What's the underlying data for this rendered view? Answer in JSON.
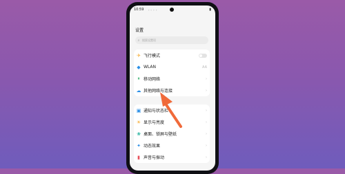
{
  "status": {
    "time": "10:59",
    "icons": "◦ ◦ ◦ ◦",
    "battery": "▮"
  },
  "title": "设置",
  "search": {
    "placeholder": "搜索设置项"
  },
  "groups": [
    {
      "items": [
        {
          "icon": "airplane-icon",
          "glyph": "✈",
          "color": "#f5a623",
          "label": "飞行模式",
          "control": "toggle",
          "value": false
        },
        {
          "icon": "wifi-icon",
          "glyph": "◆",
          "color": "#2b8fe6",
          "label": "WLAN",
          "trailing": "AA"
        },
        {
          "icon": "mobile-network-icon",
          "glyph": "⏸",
          "color": "#3cb371",
          "label": "移动网络",
          "trailing": "›"
        },
        {
          "icon": "cloud-icon",
          "glyph": "☁",
          "color": "#2b8fe6",
          "label": "其他网络与连接",
          "trailing": "›"
        }
      ]
    },
    {
      "items": [
        {
          "icon": "notification-icon",
          "glyph": "▣",
          "color": "#2b8fe6",
          "label": "通知与状态栏",
          "trailing": "›"
        },
        {
          "icon": "brightness-icon",
          "glyph": "☀",
          "color": "#f5a623",
          "label": "显示与亮度",
          "trailing": "›"
        },
        {
          "icon": "wallpaper-icon",
          "glyph": "❀",
          "color": "#2fb5a2",
          "label": "桌面、锁屏与壁纸",
          "trailing": "›"
        },
        {
          "icon": "dynamic-effects-icon",
          "glyph": "✦",
          "color": "#2b8fe6",
          "label": "动态效果",
          "trailing": "›"
        },
        {
          "icon": "sound-icon",
          "glyph": "▮",
          "color": "#e8505b",
          "label": "声音与振动",
          "trailing": "›"
        }
      ]
    }
  ],
  "arrow_color": "#f06a3a"
}
